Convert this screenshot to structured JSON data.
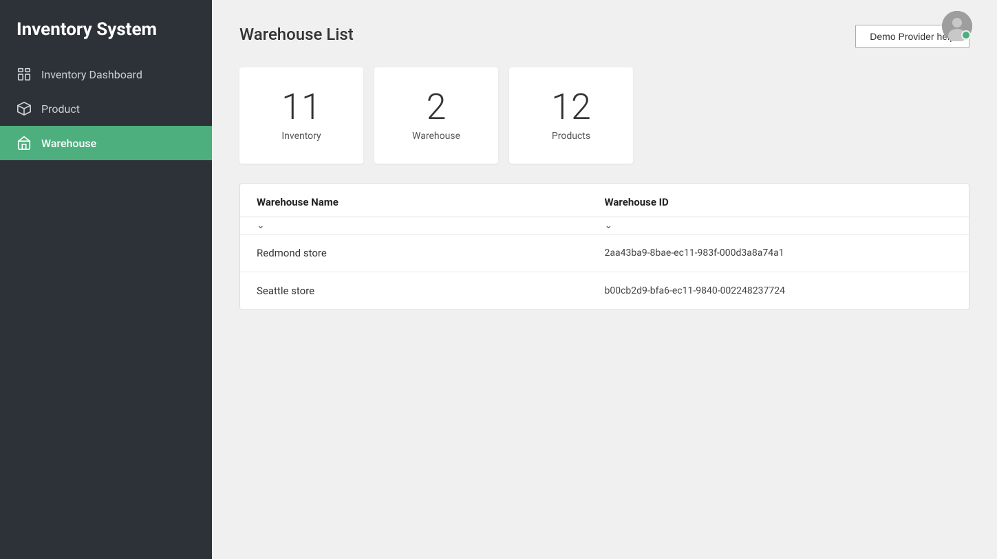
{
  "app": {
    "title": "Inventory System"
  },
  "sidebar": {
    "items": [
      {
        "id": "inventory-dashboard",
        "label": "Inventory Dashboard",
        "icon": "dashboard-icon",
        "active": false
      },
      {
        "id": "product",
        "label": "Product",
        "icon": "product-icon",
        "active": false
      },
      {
        "id": "warehouse",
        "label": "Warehouse",
        "icon": "warehouse-icon",
        "active": true
      }
    ]
  },
  "header": {
    "page_title": "Warehouse List",
    "demo_button_label": "Demo Provider help"
  },
  "stats": [
    {
      "number": "11",
      "label": "Inventory"
    },
    {
      "number": "2",
      "label": "Warehouse"
    },
    {
      "number": "12",
      "label": "Products"
    }
  ],
  "table": {
    "columns": [
      {
        "id": "warehouse-name",
        "label": "Warehouse Name"
      },
      {
        "id": "warehouse-id",
        "label": "Warehouse ID"
      }
    ],
    "rows": [
      {
        "name": "Redmond store",
        "id": "2aa43ba9-8bae-ec11-983f-000d3a8a74a1"
      },
      {
        "name": "Seattle store",
        "id": "b00cb2d9-bfa6-ec11-9840-002248237724"
      }
    ]
  },
  "user": {
    "status": "online"
  }
}
